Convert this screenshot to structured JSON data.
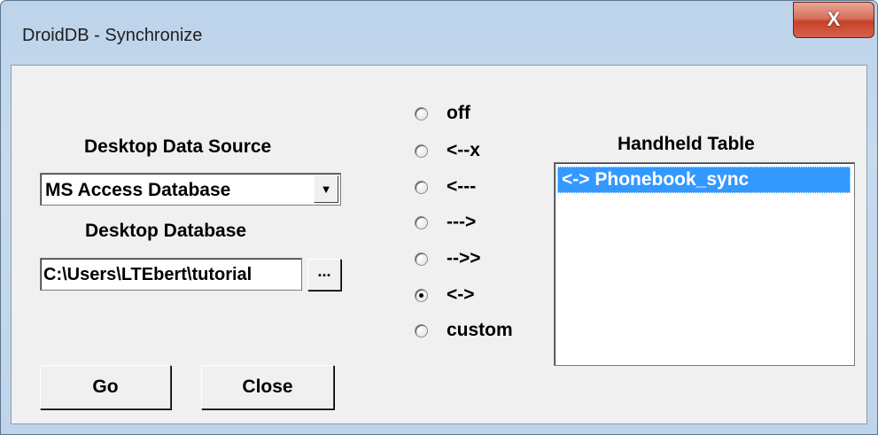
{
  "window": {
    "title": "DroidDB - Synchronize",
    "close_glyph": "X"
  },
  "desktop": {
    "source_label": "Desktop Data Source",
    "source_value": "MS Access Database",
    "database_label": "Desktop Database",
    "database_value": "C:\\Users\\LTEbert\\tutorial",
    "browse_label": "..."
  },
  "sync": {
    "options": [
      "off",
      "<--x",
      "<---",
      "--->",
      "-->>",
      "<->",
      "custom"
    ],
    "selected": "<->"
  },
  "handheld": {
    "label": "Handheld Table",
    "items": [
      "<-> Phonebook_sync"
    ],
    "selected": "<-> Phonebook_sync"
  },
  "buttons": {
    "go": "Go",
    "close": "Close"
  },
  "icons": {
    "close": "close-icon",
    "dropdown": "chevron-down-icon"
  },
  "colors": {
    "selection": "#3399ff",
    "close_button": "#c4432a",
    "dialog_bg": "#f0f0f0"
  }
}
